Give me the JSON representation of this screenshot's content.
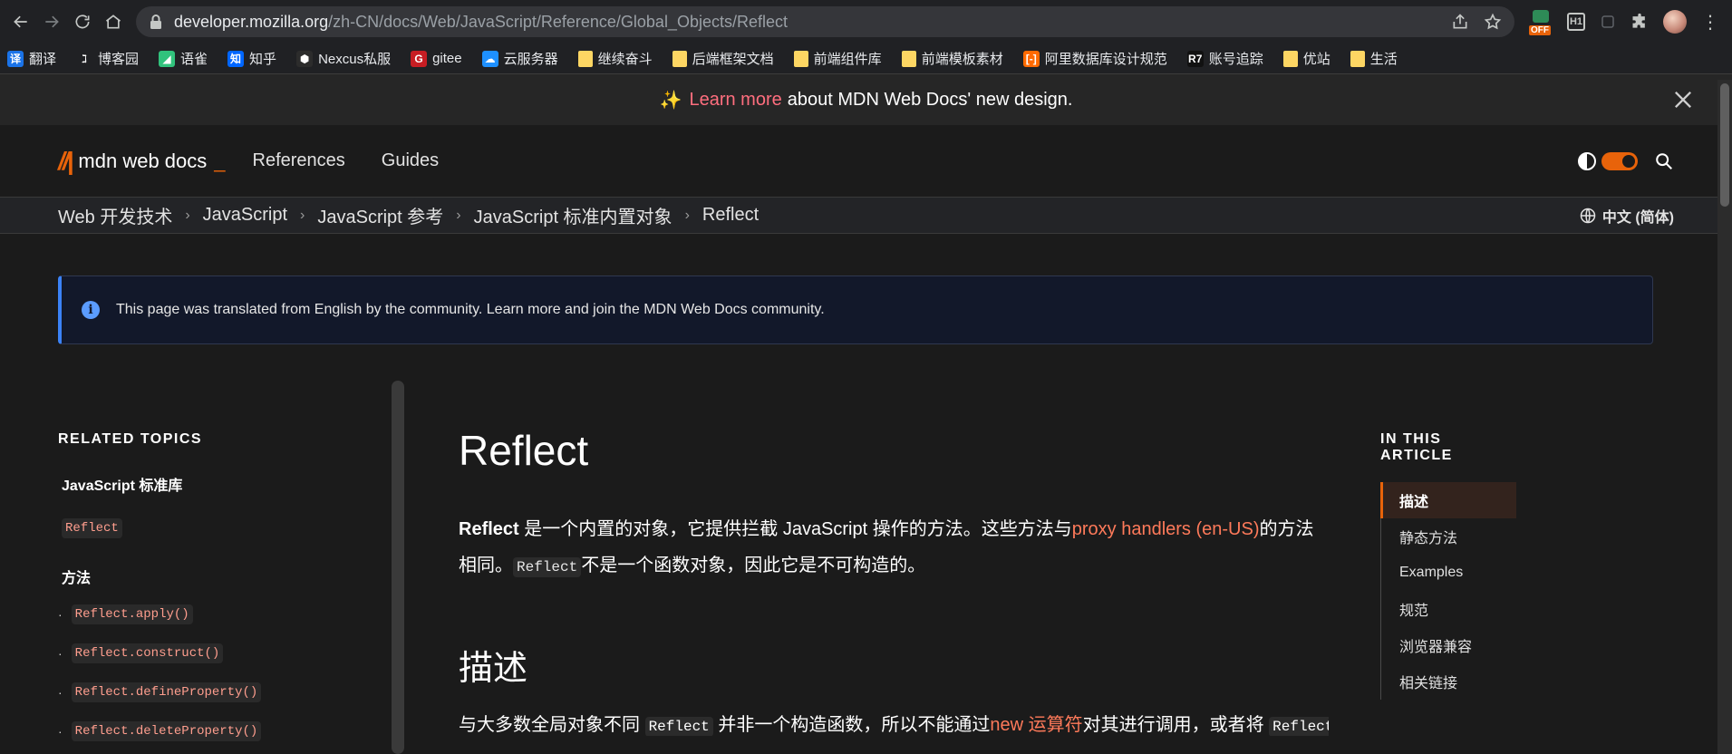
{
  "browser": {
    "url_host": "developer.mozilla.org",
    "url_path": "/zh-CN/docs/Web/JavaScript/Reference/Global_Objects/Reflect",
    "ext_off_label": "OFF",
    "ext_h1_label": "H1"
  },
  "bookmarks": [
    {
      "label": "翻译",
      "icon": "translate-icon",
      "glyph": "译",
      "color": "#1a73e8"
    },
    {
      "label": "博客园",
      "icon": "cnblogs-icon",
      "glyph": "ℷ",
      "color": "#202124"
    },
    {
      "label": "语雀",
      "icon": "yuque-icon",
      "glyph": "◢",
      "color": "#31c27c"
    },
    {
      "label": "知乎",
      "icon": "zhihu-icon",
      "glyph": "知",
      "color": "#0066ff"
    },
    {
      "label": "Nexcus私服",
      "icon": "nexus-icon",
      "glyph": "⬢",
      "color": "#2c2c2c"
    },
    {
      "label": "gitee",
      "icon": "gitee-icon",
      "glyph": "G",
      "color": "#c71d23"
    },
    {
      "label": "云服务器",
      "icon": "cloud-icon",
      "glyph": "☁",
      "color": "#1e90ff"
    },
    {
      "label": "继续奋斗",
      "icon": "folder-icon",
      "folder": true
    },
    {
      "label": "后端框架文档",
      "icon": "folder-icon",
      "folder": true
    },
    {
      "label": "前端组件库",
      "icon": "folder-icon",
      "folder": true
    },
    {
      "label": "前端模板素材",
      "icon": "folder-icon",
      "folder": true
    },
    {
      "label": "阿里数据库设计规范",
      "icon": "aliyun-icon",
      "glyph": "[-]",
      "color": "#ff6a00"
    },
    {
      "label": "账号追踪",
      "icon": "r7-icon",
      "glyph": "R7",
      "color": "#111"
    },
    {
      "label": "优站",
      "icon": "folder-icon",
      "folder": true
    },
    {
      "label": "生活",
      "icon": "folder-icon",
      "folder": true
    }
  ],
  "banner": {
    "link": "Learn more",
    "text": "about MDN Web Docs' new design."
  },
  "header": {
    "logo_text": "mdn web docs",
    "logo_cursor": "_",
    "menu": [
      "References",
      "Guides"
    ]
  },
  "breadcrumb": {
    "items": [
      "Web 开发技术",
      "JavaScript",
      "JavaScript 参考",
      "JavaScript 标准内置对象",
      "Reflect"
    ],
    "language": "中文 (简体)"
  },
  "notice": {
    "text": "This page was translated from English by the community. Learn more and join the MDN Web Docs community."
  },
  "sidebar": {
    "title": "RELATED TOPICS",
    "head": "JavaScript 标准库",
    "current": "Reflect",
    "section": "方法",
    "methods": [
      "Reflect.apply()",
      "Reflect.construct()",
      "Reflect.defineProperty()",
      "Reflect.deleteProperty()"
    ]
  },
  "article": {
    "title": "Reflect",
    "intro_bold": "Reflect",
    "intro_1": " 是一个内置的对象，它提供拦截 JavaScript 操作的方法。这些方法与",
    "intro_link": "proxy handlers (en-US)",
    "intro_2": "的方法相同。",
    "intro_code": "Reflect",
    "intro_3": "不是一个函数对象，因此它是不可构造的。",
    "h2": "描述",
    "cut_1": "与大多数全局对象不同",
    "cut_code": "Reflect",
    "cut_2": "并非一个构造函数，所以不能通过",
    "cut_link": "new 运算符",
    "cut_3": "对其进行调用，或者将",
    "cut_code2": "Reflect"
  },
  "toc": {
    "title": "IN THIS ARTICLE",
    "items": [
      "描述",
      "静态方法",
      "Examples",
      "规范",
      "浏览器兼容",
      "相关链接"
    ],
    "active_index": 0
  }
}
